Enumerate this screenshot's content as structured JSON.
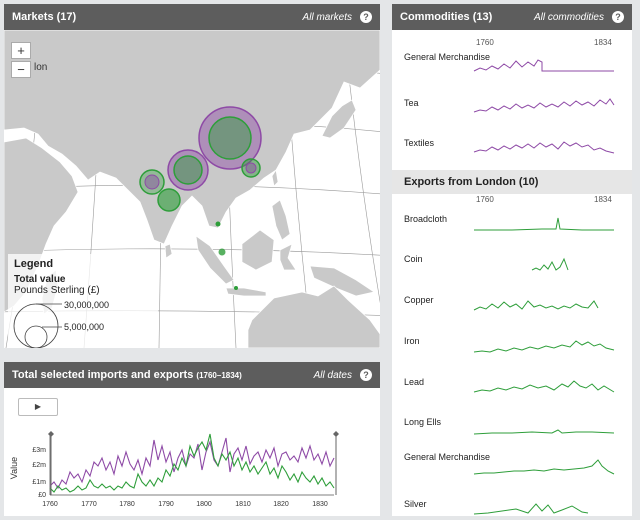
{
  "markets": {
    "title": "Markets (17)",
    "link": "All markets",
    "help": "?",
    "zoom_in": "+",
    "zoom_out": "−",
    "map_label": "lon",
    "legend": {
      "title": "Legend",
      "subtitle": "Total value",
      "units": "Pounds Sterling (£)",
      "large_label": "30,000,000",
      "small_label": "5,000,000"
    }
  },
  "totals": {
    "title": "Total selected imports and exports",
    "range": "(1760–1834)",
    "link": "All dates",
    "help": "?",
    "play": "▶",
    "y_title": "Value",
    "y_ticks": [
      "£0",
      "£1m",
      "£2m",
      "£3m"
    ],
    "x_ticks": [
      "1760",
      "1770",
      "1780",
      "1790",
      "1800",
      "1810",
      "1820",
      "1830"
    ]
  },
  "commodities": {
    "title": "Commodities (13)",
    "link": "All commodities",
    "help": "?",
    "start_year": "1760",
    "end_year": "1834",
    "items": [
      "General Merchandise",
      "Tea",
      "Textiles"
    ]
  },
  "exports": {
    "title": "Exports from London (10)",
    "start_year": "1760",
    "end_year": "1834",
    "items": [
      "Broadcloth",
      "Coin",
      "Copper",
      "Iron",
      "Lead",
      "Long Ells",
      "General Merchandise",
      "Silver"
    ]
  },
  "colors": {
    "imports": "#8e4aa6",
    "exports": "#2e9e3a",
    "header": "#5d5d5d"
  }
}
